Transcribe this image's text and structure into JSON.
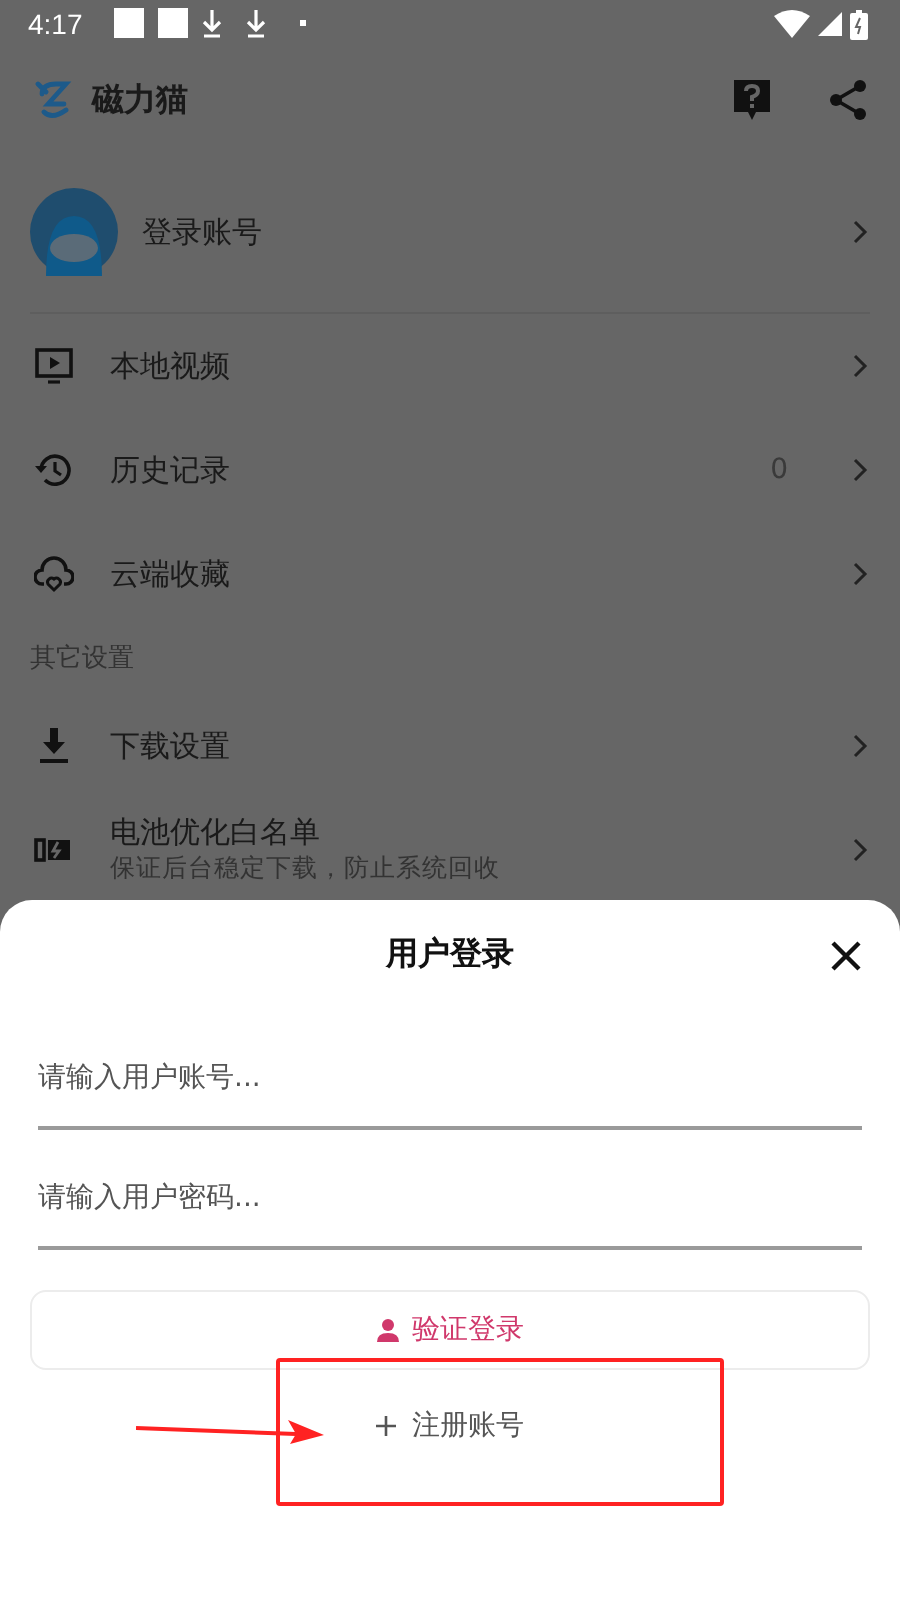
{
  "status_bar": {
    "time": "4:17"
  },
  "app_bar": {
    "title": "磁力猫"
  },
  "profile": {
    "label": "登录账号"
  },
  "menu": [
    {
      "label": "本地视频"
    },
    {
      "label": "历史记录",
      "count": "0"
    },
    {
      "label": "云端收藏"
    }
  ],
  "section": {
    "title": "其它设置"
  },
  "settings": [
    {
      "label": "下载设置"
    },
    {
      "label": "电池优化白名单",
      "subtitle": "保证后台稳定下载，防止系统回收"
    }
  ],
  "login_sheet": {
    "title": "用户登录",
    "fields": [
      {
        "placeholder": "请输入用户账号..."
      },
      {
        "placeholder": "请输入用户密码..."
      }
    ],
    "login_button": "验证登录",
    "register_button": "注册账号"
  }
}
